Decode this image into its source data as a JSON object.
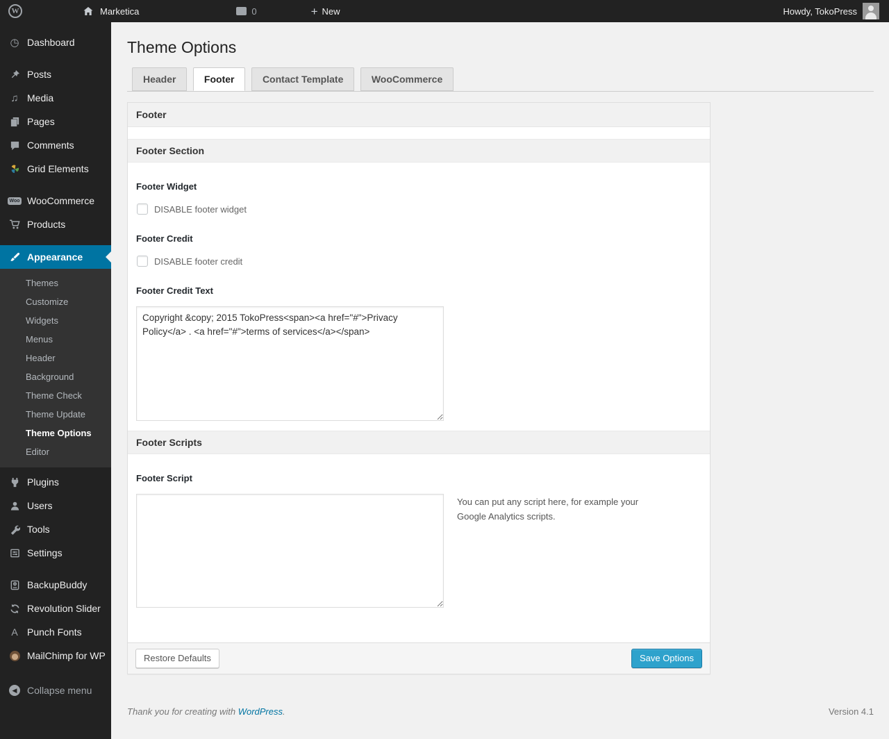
{
  "admin_bar": {
    "site_name": "Marketica",
    "comments_count": "0",
    "new_label": "New",
    "howdy": "Howdy, TokoPress"
  },
  "sidebar": {
    "items": [
      {
        "label": "Dashboard"
      },
      {
        "label": "Posts"
      },
      {
        "label": "Media"
      },
      {
        "label": "Pages"
      },
      {
        "label": "Comments"
      },
      {
        "label": "Grid Elements"
      },
      {
        "label": "WooCommerce"
      },
      {
        "label": "Products"
      },
      {
        "label": "Appearance"
      },
      {
        "label": "Plugins"
      },
      {
        "label": "Users"
      },
      {
        "label": "Tools"
      },
      {
        "label": "Settings"
      },
      {
        "label": "BackupBuddy"
      },
      {
        "label": "Revolution Slider"
      },
      {
        "label": "Punch Fonts"
      },
      {
        "label": "MailChimp for WP"
      }
    ],
    "appearance_submenu": [
      {
        "label": "Themes"
      },
      {
        "label": "Customize"
      },
      {
        "label": "Widgets"
      },
      {
        "label": "Menus"
      },
      {
        "label": "Header"
      },
      {
        "label": "Background"
      },
      {
        "label": "Theme Check"
      },
      {
        "label": "Theme Update"
      },
      {
        "label": "Theme Options"
      },
      {
        "label": "Editor"
      }
    ],
    "collapse_label": "Collapse menu"
  },
  "main": {
    "page_title": "Theme Options",
    "tabs": [
      {
        "label": "Header"
      },
      {
        "label": "Footer"
      },
      {
        "label": "Contact Template"
      },
      {
        "label": "WooCommerce"
      }
    ]
  },
  "panel": {
    "box_title": "Footer",
    "section_footer": {
      "title": "Footer Section",
      "footer_widget_label": "Footer Widget",
      "footer_widget_checkbox": "DISABLE footer widget",
      "footer_credit_label": "Footer Credit",
      "footer_credit_checkbox": "DISABLE footer credit",
      "footer_credit_text_label": "Footer Credit Text",
      "footer_credit_text_value": "Copyright &copy; 2015 TokoPress<span><a href=\"#\">Privacy Policy</a> . <a href=\"#\">terms of services</a></span>"
    },
    "section_scripts": {
      "title": "Footer Scripts",
      "footer_script_label": "Footer Script",
      "footer_script_value": "",
      "footer_script_help": "You can put any script here, for example your Google Analytics scripts."
    },
    "actions": {
      "restore_label": "Restore Defaults",
      "save_label": "Save Options"
    }
  },
  "page_footer": {
    "thanks_text": "Thank you for creating with",
    "wordpress_link": "WordPress",
    "period": ".",
    "version": "Version 4.1"
  },
  "colors": {
    "accent_blue": "#0074a2",
    "primary_button": "#2ea2cc",
    "menu_dark": "#222222",
    "submenu_dark": "#333333",
    "content_bg": "#f1f1f1"
  }
}
